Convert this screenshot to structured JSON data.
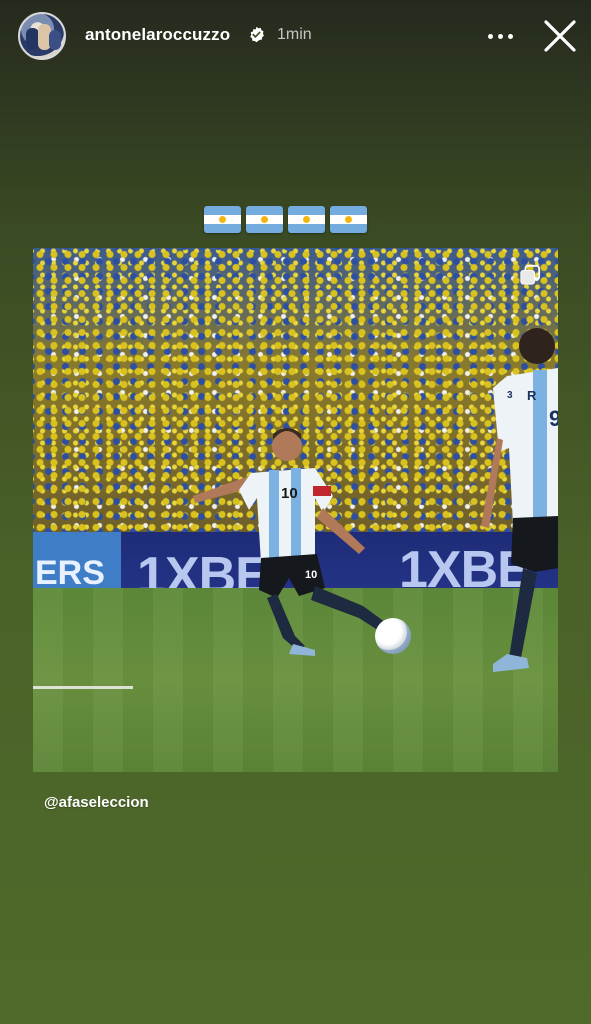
{
  "story": {
    "username": "antonelaroccuzzo",
    "timestamp": "1min",
    "mention": "@afaseleccion",
    "flag_emoji": "🇦🇷",
    "flag_count": 4
  },
  "photo": {
    "ad_left_text": "ERS",
    "ad_text_1": "1XBE",
    "ad_text_2": "1XBE",
    "jersey_number_main": "10",
    "jersey_number_right": "9",
    "jersey_name_right": "R",
    "jersey_number_right_small": "3"
  },
  "icons": {
    "verified": "verified-badge-icon",
    "more": "more-options-icon",
    "close": "close-icon",
    "multi_post": "carousel-icon"
  },
  "colors": {
    "argentina_blue": "#74acdf",
    "argentina_sun": "#f6b40e",
    "verified_blue": "#3897f0"
  }
}
